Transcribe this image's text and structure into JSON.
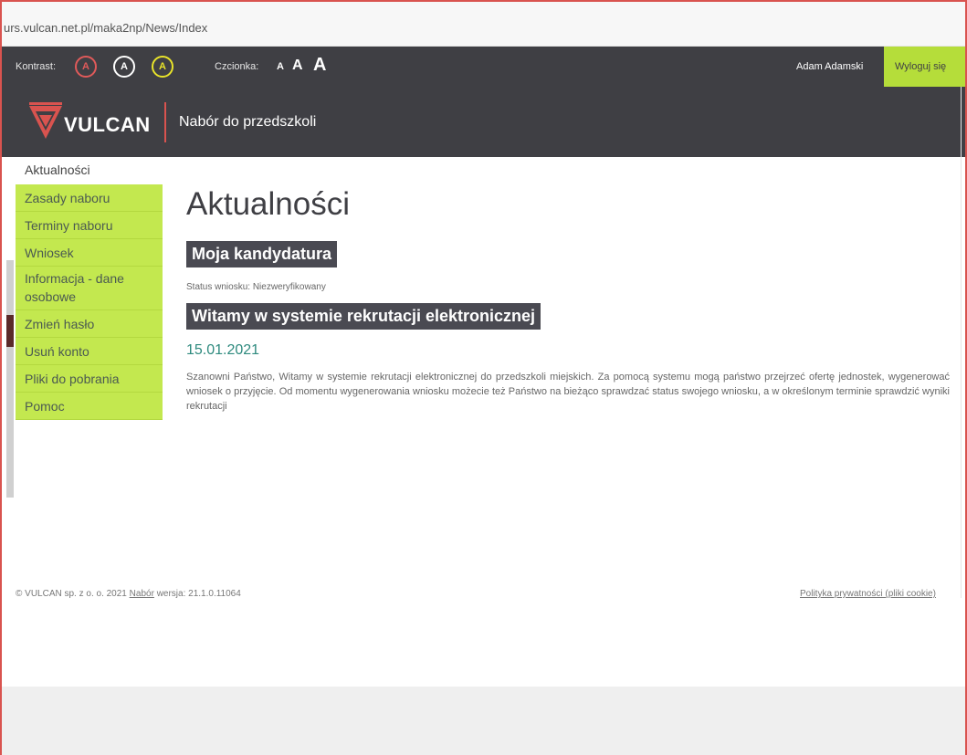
{
  "browser": {
    "url": "urs.vulcan.net.pl/maka2np/News/Index"
  },
  "accessibility": {
    "contrast_label": "Kontrast:",
    "contrast_buttons": [
      {
        "label": "A",
        "border": "#e05a5a",
        "text": "#e05a5a",
        "bg": "#3f3f44"
      },
      {
        "label": "A",
        "border": "#ffffff",
        "text": "#ffffff",
        "bg": "#3f3f44"
      },
      {
        "label": "A",
        "border": "#e8e32a",
        "text": "#e8e32a",
        "bg": "#3f3f44"
      }
    ],
    "font_label": "Czcionka:",
    "font_sizes": [
      "A",
      "A",
      "A"
    ]
  },
  "user": {
    "name": "Adam Adamski",
    "logout": "Wyloguj się"
  },
  "brand": {
    "logo_text": "VULCAN",
    "app_title": "Nabór do przedszkoli",
    "logo_color": "#d9534f"
  },
  "sidebar": {
    "items": [
      {
        "label": "Aktualności",
        "active": true
      },
      {
        "label": "Zasady naboru"
      },
      {
        "label": "Terminy naboru"
      },
      {
        "label": "Wniosek"
      },
      {
        "label": "Informacja - dane osobowe"
      },
      {
        "label": "Zmień hasło"
      },
      {
        "label": "Usuń konto"
      },
      {
        "label": "Pliki do pobrania"
      },
      {
        "label": "Pomoc"
      }
    ]
  },
  "main": {
    "title": "Aktualności",
    "candidacy_header": "Moja kandydatura",
    "status_text": "Status wniosku: Niezweryfikowany",
    "news_header": "Witamy w systemie rekrutacji elektronicznej",
    "news_date": "15.01.2021",
    "news_body": "Szanowni Państwo, Witamy w systemie rekrutacji elektronicznej do przedszkoli miejskich. Za pomocą systemu mogą państwo przejrzeć ofertę jednostek, wygenerować wniosek o przyjęcie. Od momentu wygenerowania wniosku możecie też Państwo na bieżąco sprawdzać status swojego wniosku, a w określonym terminie sprawdzić wyniki rekrutacji"
  },
  "footer": {
    "copyright": "© VULCAN sp. z o. o. 2021",
    "app_link": "Nabór",
    "version": "wersja: 21.1.0.11064",
    "privacy_link": "Polityka prywatności (pliki cookie)"
  },
  "colors": {
    "header_bg": "#3f3f44",
    "accent_green": "#c3e84f",
    "logout_bg": "#b5dd3a",
    "date_teal": "#2e8a7e"
  }
}
